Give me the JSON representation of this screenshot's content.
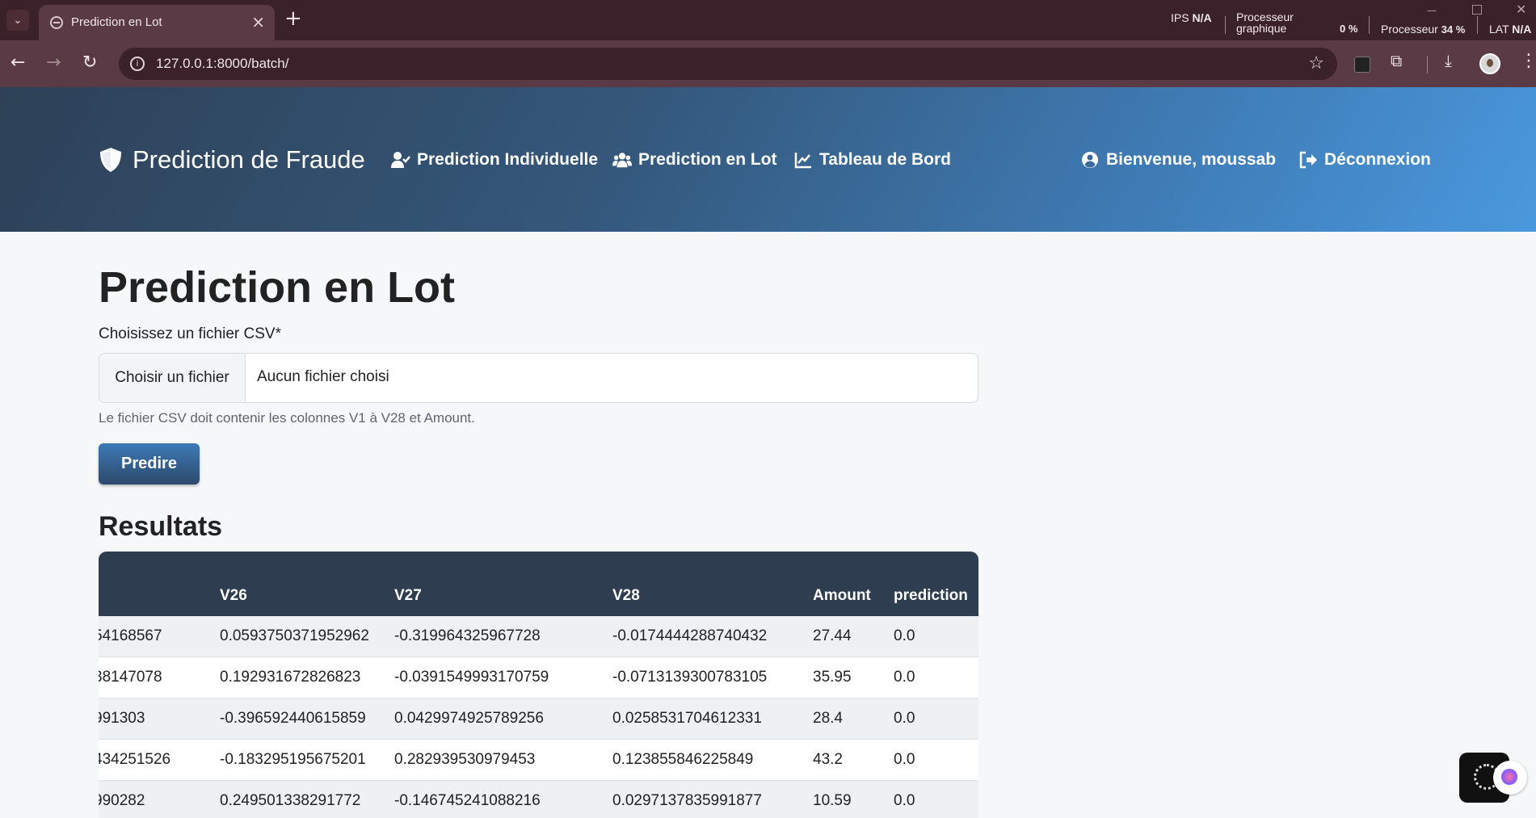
{
  "browser": {
    "tab_title": "Prediction en Lot",
    "url": "127.0.0.1:8000/batch/",
    "perf": {
      "ips_label": "IPS",
      "ips_value": "N/A",
      "gpu_label_1": "Processeur",
      "gpu_label_2": "graphique",
      "gpu_value": "0 %",
      "cpu_label": "Processeur",
      "cpu_value": "34 %",
      "lat_label": "LAT",
      "lat_value": "N/A"
    }
  },
  "header": {
    "brand": "Prediction de Fraude",
    "nav": {
      "individual": "Prediction Individuelle",
      "batch": "Prediction en Lot",
      "dashboard": "Tableau de Bord",
      "welcome": "Bienvenue, moussab",
      "logout": "Déconnexion"
    }
  },
  "main": {
    "title": "Prediction en Lot",
    "file_label": "Choisissez un fichier CSV*",
    "file_button": "Choisir un fichier",
    "file_status": "Aucun fichier choisi",
    "help": "Le fichier CSV doit contenir les colonnes V1 à V28 et Amount.",
    "predict_button": "Predire",
    "results_title": "Resultats",
    "table": {
      "columns": [
        "V26",
        "V27",
        "V28",
        "Amount",
        "prediction"
      ],
      "rows": [
        [
          "54168567",
          "0.0593750371952962",
          "-0.319964325967728",
          "-0.0174444288740432",
          "27.44",
          "0.0"
        ],
        [
          "38147078",
          "0.192931672826823",
          "-0.0391549993170759",
          "-0.0713139300783105",
          "35.95",
          "0.0"
        ],
        [
          "991303",
          "-0.396592440615859",
          "0.0429974925789256",
          "0.0258531704612331",
          "28.4",
          "0.0"
        ],
        [
          "434251526",
          "-0.183295195675201",
          "0.282939530979453",
          "0.123855846225849",
          "43.2",
          "0.0"
        ],
        [
          "990282",
          "0.249501338291772",
          "-0.146745241088216",
          "0.0297137835991877",
          "10.59",
          "0.0"
        ]
      ]
    }
  },
  "colors": {
    "header_start": "#2e4157",
    "header_end": "#4a98de",
    "table_header": "#2e3d50",
    "button": "#3d79b7"
  }
}
